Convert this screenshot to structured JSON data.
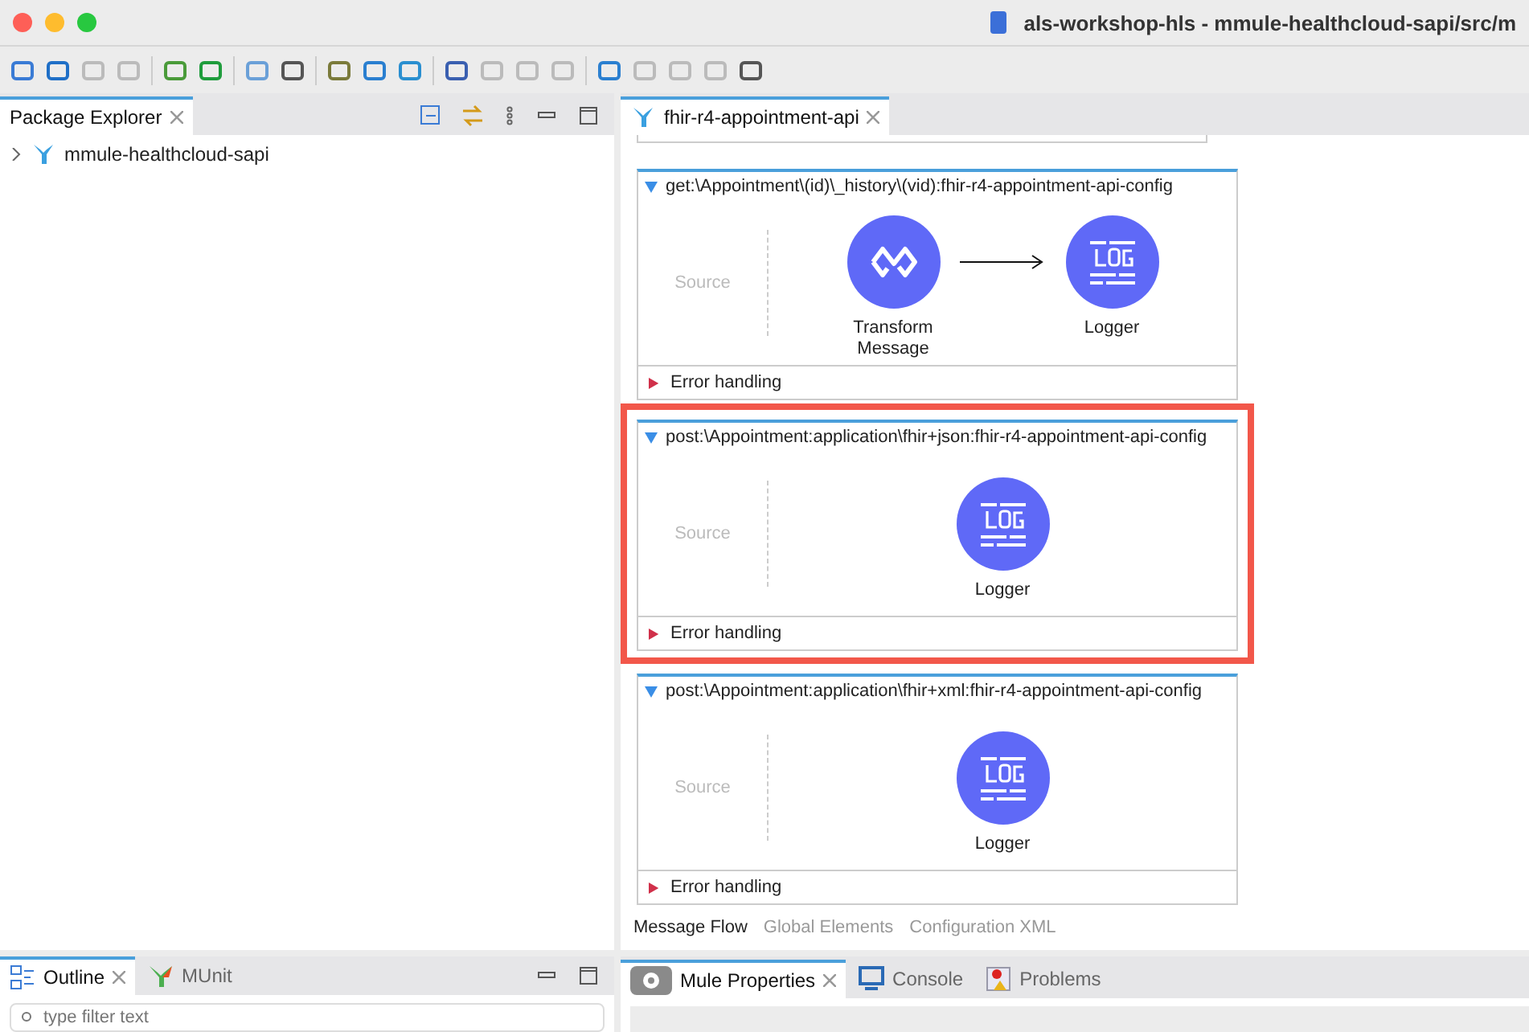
{
  "window": {
    "title": "als-workshop-hls - mmule-healthcloud-sapi/src/m"
  },
  "left_panel": {
    "tabs": [
      {
        "label": "Package Explorer",
        "selected": true
      }
    ],
    "tree": [
      {
        "label": "mmule-healthcloud-sapi",
        "expanded": false
      }
    ]
  },
  "editor": {
    "tabs": [
      {
        "label": "fhir-r4-appointment-api",
        "selected": true
      }
    ],
    "flows": [
      {
        "name": "get:\\Appointment\\(id)\\_history\\(vid):fhir-r4-appointment-api-config",
        "source_label": "Source",
        "highlighted": false,
        "expanded": true,
        "components": [
          {
            "kind": "transform",
            "label": "Transform Message"
          },
          {
            "kind": "logger",
            "label": "Logger"
          }
        ],
        "error_handling": {
          "label": "Error handling",
          "expanded": false
        }
      },
      {
        "name": "post:\\Appointment:application\\fhir+json:fhir-r4-appointment-api-config",
        "source_label": "Source",
        "highlighted": true,
        "expanded": true,
        "components": [
          {
            "kind": "logger",
            "label": "Logger"
          }
        ],
        "error_handling": {
          "label": "Error handling",
          "expanded": false
        }
      },
      {
        "name": "post:\\Appointment:application\\fhir+xml:fhir-r4-appointment-api-config",
        "source_label": "Source",
        "highlighted": false,
        "expanded": true,
        "components": [
          {
            "kind": "logger",
            "label": "Logger"
          }
        ],
        "error_handling": {
          "label": "Error handling",
          "expanded": false
        }
      }
    ],
    "view_tabs": [
      {
        "label": "Message Flow",
        "selected": true
      },
      {
        "label": "Global Elements",
        "selected": false
      },
      {
        "label": "Configuration XML",
        "selected": false
      }
    ]
  },
  "bottom_left": {
    "tabs": [
      {
        "label": "Outline",
        "selected": true,
        "kind": "outline"
      },
      {
        "label": "MUnit",
        "selected": false,
        "kind": "munit"
      }
    ],
    "filter": {
      "placeholder": "type filter text"
    }
  },
  "bottom_right": {
    "tabs": [
      {
        "label": "Mule Properties",
        "selected": true,
        "kind": "properties"
      },
      {
        "label": "Console",
        "selected": false,
        "kind": "console"
      },
      {
        "label": "Problems",
        "selected": false,
        "kind": "problems"
      }
    ]
  }
}
